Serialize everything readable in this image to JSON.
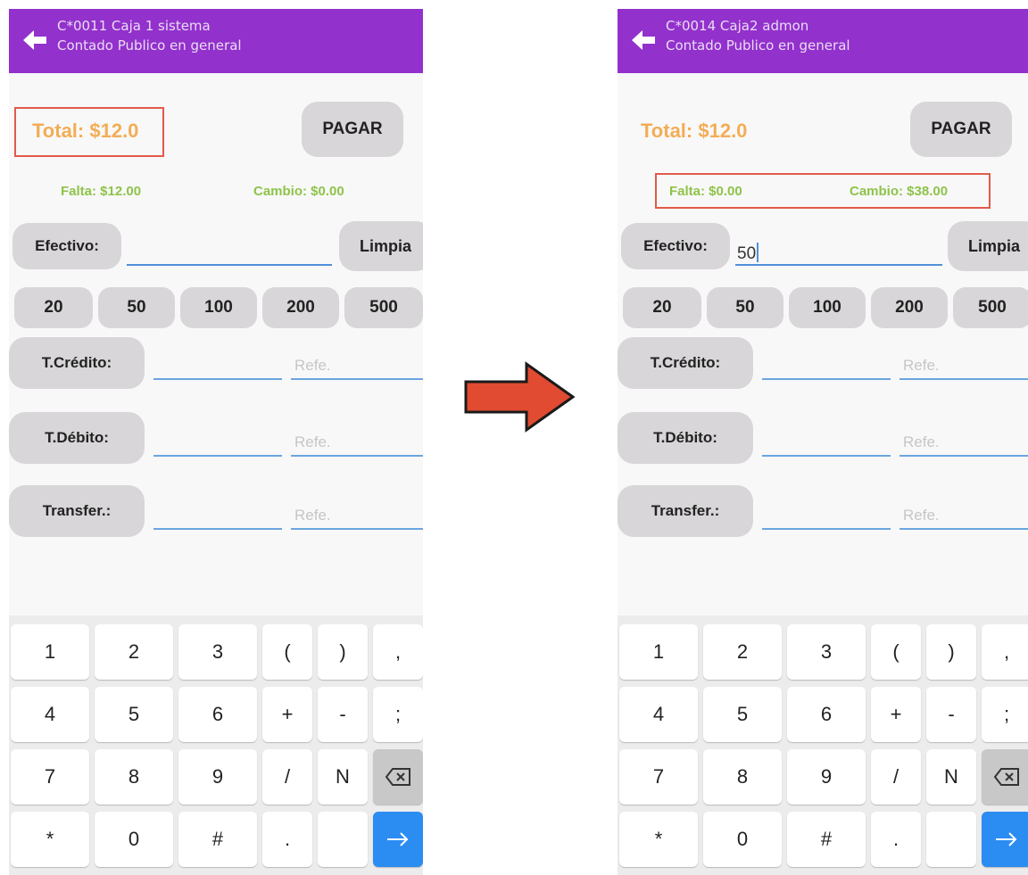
{
  "screens": [
    {
      "header": {
        "title": "C*0011 Caja 1 sistema",
        "subtitle": "Contado Publico en general"
      },
      "total_label": "Total: $12.0",
      "pay_label": "PAGAR",
      "falta": "Falta: $12.00",
      "cambio": "Cambio: $0.00",
      "efectivo_label": "Efectivo:",
      "efectivo_value": "",
      "limpia_label": "Limpia",
      "quick_amounts": [
        "20",
        "50",
        "100",
        "200",
        "500"
      ],
      "payment_methods": [
        "T.Crédito:",
        "T.Débito:",
        "Transfer.:"
      ],
      "reference_placeholder": "Refe."
    },
    {
      "header": {
        "title": "C*0014 Caja2 admon",
        "subtitle": "Contado Publico en general"
      },
      "total_label": "Total: $12.0",
      "pay_label": "PAGAR",
      "falta": "Falta: $0.00",
      "cambio": "Cambio: $38.00",
      "efectivo_label": "Efectivo:",
      "efectivo_value": "50",
      "limpia_label": "Limpia",
      "quick_amounts": [
        "20",
        "50",
        "100",
        "200",
        "500"
      ],
      "payment_methods": [
        "T.Crédito:",
        "T.Débito:",
        "Transfer.:"
      ],
      "reference_placeholder": "Refe."
    }
  ],
  "keyboard": {
    "rows": [
      [
        "1",
        "2",
        "3",
        "(",
        ")",
        ","
      ],
      [
        "4",
        "5",
        "6",
        "+",
        "-",
        ";"
      ],
      [
        "7",
        "8",
        "9",
        "/",
        "N",
        ""
      ],
      [
        "*",
        "0",
        "#",
        ".",
        "",
        ""
      ]
    ],
    "icons": {
      "backspace": "backspace-icon",
      "enter": "arrow-right-icon"
    }
  },
  "colors": {
    "header_bg": "#9331cc",
    "total_text": "#f3ad56",
    "status_text": "#8ec34a",
    "highlight": "#e15a4a",
    "input_line": "#6aa5e0",
    "enter_key": "#2b8cf2",
    "arrow_fill": "#e04b32"
  }
}
